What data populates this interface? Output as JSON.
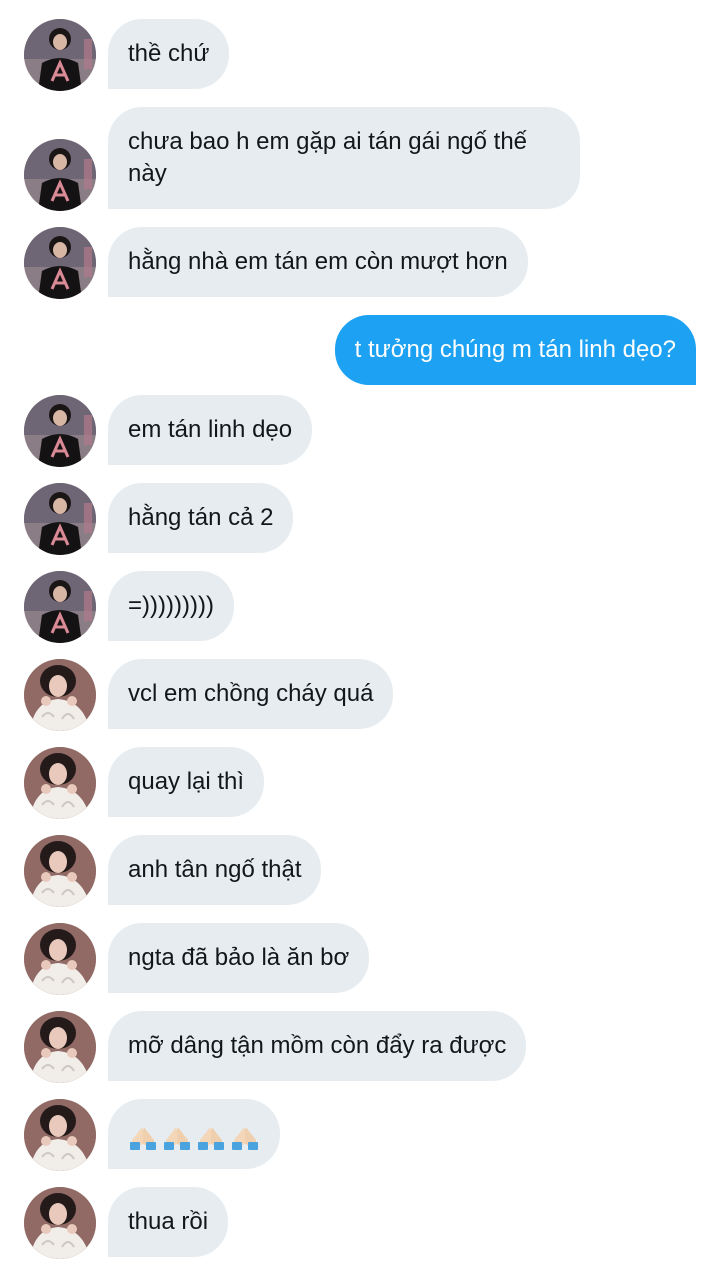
{
  "colors": {
    "incoming_bubble": "#e6ecf0",
    "outgoing_bubble": "#1da1f2",
    "text_dark": "#14171a",
    "text_light": "#ffffff"
  },
  "messages": [
    {
      "direction": "in",
      "avatar": "avatar-dark-shirt",
      "text": "thề chứ"
    },
    {
      "direction": "in",
      "avatar": "avatar-dark-shirt",
      "text": "chưa bao h em gặp ai tán gái ngố thế này"
    },
    {
      "direction": "in",
      "avatar": "avatar-dark-shirt",
      "text": "hằng nhà em tán em còn mượt hơn"
    },
    {
      "direction": "out",
      "text": "t tưởng chúng m tán linh dẹo?"
    },
    {
      "direction": "in",
      "avatar": "avatar-dark-shirt",
      "text": "em tán linh dẹo"
    },
    {
      "direction": "in",
      "avatar": "avatar-dark-shirt",
      "text": "hằng tán cả 2"
    },
    {
      "direction": "in",
      "avatar": "avatar-dark-shirt",
      "text": "=)))))))))"
    },
    {
      "direction": "in",
      "avatar": "avatar-white-sweater",
      "text": "vcl em chồng cháy quá"
    },
    {
      "direction": "in",
      "avatar": "avatar-white-sweater",
      "text": "quay lại thì"
    },
    {
      "direction": "in",
      "avatar": "avatar-white-sweater",
      "text": "anh tân ngố thật"
    },
    {
      "direction": "in",
      "avatar": "avatar-white-sweater",
      "text": "ngta đã bảo là ăn bơ"
    },
    {
      "direction": "in",
      "avatar": "avatar-white-sweater",
      "text": "mỡ dâng tận mồm còn đẩy ra được"
    },
    {
      "direction": "in",
      "avatar": "avatar-white-sweater",
      "emoji": [
        "folded-hands-icon",
        "folded-hands-icon",
        "folded-hands-icon",
        "folded-hands-icon"
      ]
    },
    {
      "direction": "in",
      "avatar": "avatar-white-sweater",
      "text": "thua rồi"
    }
  ]
}
